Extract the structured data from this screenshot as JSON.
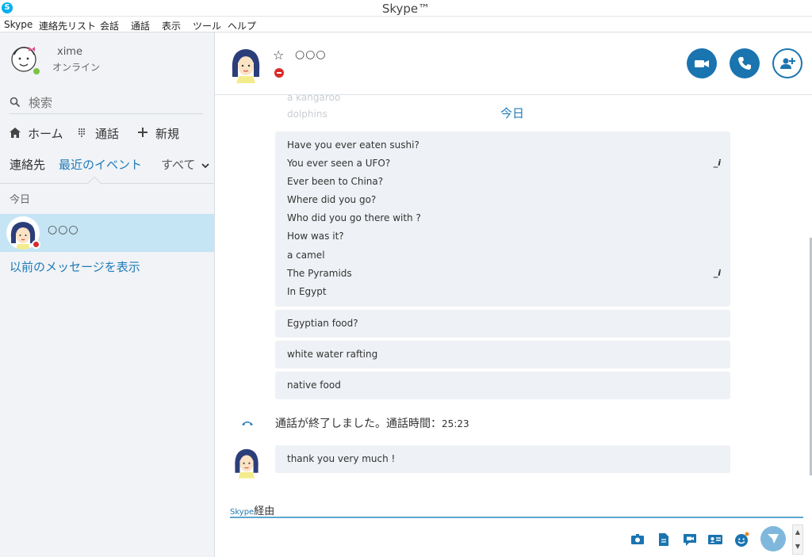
{
  "window": {
    "title": "Skype™",
    "logo_letter": "S"
  },
  "menu": [
    "Skype",
    "連絡先リスト",
    "会話",
    "通話",
    "表示",
    "ツール",
    "ヘルプ"
  ],
  "profile": {
    "name": "xime",
    "status": "オンライン"
  },
  "search": {
    "placeholder": "検索"
  },
  "nav": {
    "home": "ホーム",
    "calls": "通話",
    "new": "新規"
  },
  "tabs": {
    "contacts": "連絡先",
    "recent": "最近のイベント",
    "filter": "すべて"
  },
  "recent_section": "今日",
  "recent_items": [
    {
      "name": "○○○",
      "status_color": "#d92b2b"
    }
  ],
  "older_messages_link": "以前のメッセージを表示",
  "conversation": {
    "contact_name": "○○○",
    "status": "do-not-disturb",
    "buttons": [
      "video-call",
      "voice-call",
      "add-people"
    ]
  },
  "chat": {
    "faded_lines": [
      "a kangaroo",
      "dolphins"
    ],
    "day_separator": "今日",
    "first_bubble_lines": [
      "Have you ever eaten sushi?",
      "You ever seen a UFO?",
      "Ever been to China?",
      "Where did you go?",
      "Who did you go there with ?",
      "How was it?",
      "a camel",
      "The Pyramids",
      "In Egypt"
    ],
    "edited_marker": "_i",
    "single_bubbles": [
      "Egyptian food?",
      "white water rafting",
      "native food"
    ],
    "call_ended_text": "通話が終了しました。通話時間：",
    "call_duration": "25:23",
    "reply": "thank you very much !"
  },
  "compose": {
    "via_brand": "Skype",
    "via_suffix": "経由"
  },
  "colors": {
    "accent": "#1a74b0",
    "selected_row": "#c5e5f5",
    "bubble": "#eef1f5",
    "sidebar": "#f1f3f6",
    "busy": "#d92b2b"
  }
}
